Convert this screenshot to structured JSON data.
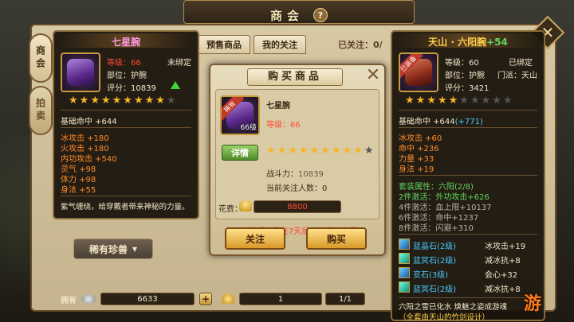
{
  "shop": {
    "title": "商会",
    "help": "?",
    "side_tabs": [
      "商会",
      "拍卖"
    ],
    "top_tabs": [
      "预售商品",
      "我的关注",
      "已关注：0/"
    ],
    "owned_label": "拥有",
    "silver": "6633",
    "gold": "1",
    "pager": "1/1",
    "pet_tab": "稀有珍兽",
    "pet_chevron": "▾"
  },
  "left_tip": {
    "name": "七星腕",
    "level_label": "等级：",
    "level_value": "66",
    "bind": "未绑定",
    "slot": "部位：护腕",
    "score": "评分：10839",
    "stars_on": 9,
    "stars_total": 10,
    "base": "基础命中 +644",
    "stats": [
      "冰攻击 +180",
      "火攻击 +180",
      "内功攻击 +540",
      "灵气 +98",
      "体力 +98",
      "身法 +55"
    ],
    "desc": "紫气缠绕，给穿戴者带来神秘的力量。"
  },
  "dialog": {
    "title": "购买商品",
    "close": "✕",
    "item_name": "七星腕",
    "badge": "稀有",
    "level_tag": "66级",
    "level_label": "等级：",
    "level_value": "66",
    "detail_btn": "详情",
    "stars_on": 9,
    "stars_total": 10,
    "power_label": "战斗力：",
    "power_value": "10839",
    "watchers": "当前关注人数：0",
    "cost_label": "花费：",
    "cost_value": "8800",
    "notice": "购买后物品在7天后方可再次交易",
    "follow_btn": "关注",
    "buy_btn": "购买"
  },
  "right_tip": {
    "name": "天山 · 六阳腕",
    "name_suffix": "+54",
    "badge": "已装备",
    "level": "等级：60",
    "bind": "已绑定",
    "slot": "部位：护腕",
    "sect": "门派：天山",
    "score": "评分：3421",
    "stars_on": 5,
    "stars_total": 10,
    "base": "基础命中 +644",
    "base_bonus": "(+771)",
    "stats": [
      "冰攻击 +60",
      "命中 +236",
      "力量 +33",
      "身法 +19"
    ],
    "set_title": "套装属性：六阳(2/8)",
    "set_lines": [
      {
        "text": "2件激活：外功攻击+626",
        "active": true
      },
      {
        "text": "4件激活：血上限+10137",
        "active": false
      },
      {
        "text": "6件激活：命中+1237",
        "active": false
      },
      {
        "text": "8件激活：闪避+310",
        "active": false
      }
    ],
    "gems": [
      {
        "name": "蓝晶石(2级)",
        "effect": "冰攻击+19"
      },
      {
        "name": "蓝冥石(2级)",
        "effect": "减冰抗+8"
      },
      {
        "name": "变石(3级)",
        "effect": "会心+32"
      },
      {
        "name": "蓝冥石(2级)",
        "effect": "减冰抗+8"
      }
    ],
    "flavor": "六阳之雪已化水 焕魅之姿成游魂",
    "flavor2": "（全套由天山的竹剑设计）"
  },
  "watermark": "游"
}
